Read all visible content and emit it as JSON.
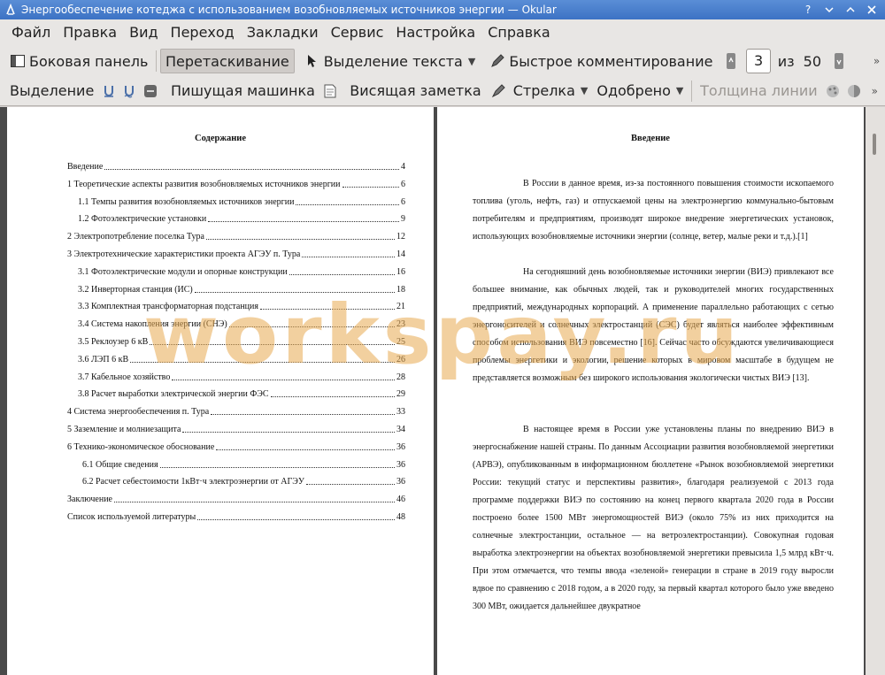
{
  "window": {
    "title": "Энергообеспечение котеджа с использованием возобновляемых источников энергии  — Okular",
    "icons": [
      "okular-app-icon",
      "help-icon",
      "minimize-icon",
      "maximize-icon",
      "close-icon"
    ]
  },
  "menu": [
    "Файл",
    "Правка",
    "Вид",
    "Переход",
    "Закладки",
    "Сервис",
    "Настройка",
    "Справка"
  ],
  "toolbar1": {
    "sidebar": "Боковая панель",
    "drag": "Перетаскивание",
    "text_select": "Выделение текста",
    "quick_comment": "Быстрое комментирование",
    "page_current": "3",
    "page_of": "из",
    "page_total": "50"
  },
  "toolbar2": {
    "selection": "Выделение",
    "typewriter": "Пишущая машинка",
    "note": "Висящая заметка",
    "arrow": "Стрелка",
    "approved": "Одобрено",
    "line_width": "Толщина линии"
  },
  "left_page": {
    "heading": "Содержание",
    "toc": [
      {
        "title": "Введение",
        "page": "4"
      },
      {
        "title": "1 Теоретические аспекты развития возобновляемых источников энергии",
        "page": "6"
      },
      {
        "title": "1.1 Темпы развития возобновляемых источников энергии",
        "page": "6"
      },
      {
        "title": "1.2 Фотоэлектрические установки",
        "page": "9"
      },
      {
        "title": "2 Электропотребление поселка Тура",
        "page": "12"
      },
      {
        "title": "3 Электротехнические характеристики проекта АГЭУ п. Тура",
        "page": "14"
      },
      {
        "title": "3.1 Фотоэлектрические модули и опорные конструкции",
        "page": "16"
      },
      {
        "title": "3.2 Инверторная станция (ИС)",
        "page": "18"
      },
      {
        "title": "3.3 Комплектная трансформаторная подстанция",
        "page": "21"
      },
      {
        "title": "3.4 Система накопления энергии (СНЭ)",
        "page": "23"
      },
      {
        "title": "3.5 Реклоузер 6 кВ",
        "page": "25"
      },
      {
        "title": "3.6 ЛЭП 6 кВ",
        "page": "26"
      },
      {
        "title": "3.7 Кабельное хозяйство",
        "page": "28"
      },
      {
        "title": "3.8 Расчет выработки электрической энергии ФЭС",
        "page": "29"
      },
      {
        "title": "4 Система энергообеспечения п. Тура",
        "page": "33"
      },
      {
        "title": "5 Заземление и молниезащита",
        "page": "34"
      },
      {
        "title": "6 Технико-экономическое обоснование",
        "page": "36"
      },
      {
        "title": "6.1 Общие сведения",
        "page": "36"
      },
      {
        "title": "6.2 Расчет себестоимости 1кВт·ч электроэнергии от АГЭУ",
        "page": "36"
      },
      {
        "title": "Заключение",
        "page": "46"
      },
      {
        "title": "Список используемой литературы",
        "page": "48"
      }
    ]
  },
  "right_page": {
    "heading": "Введение",
    "paragraphs": [
      "В России в данное время, из-за постоянного повышения стоимости ископаемого топлива (уголь, нефть, газ) и отпускаемой цены на электроэнергию коммунально-бытовым потребителям и предприятиям, производят широкое внедрение энергетических установок, использующих возобновляемые источники энергии (солнце, ветер, малые реки и т.д.).[1]",
      "На сегодняшний день возобновляемые источники энергии (ВИЭ) привлекают все большее внимание, как обычных людей, так и руководителей многих государственных предприятий, международных корпораций. А применение параллельно работающих с сетью энергоносителей и солнечных электростанций (СЭС) будет являться наиболее эффективным способом использования ВИЭ повсеместно [16]. Сейчас часто обсуждаются увеличивающиеся проблемы энергетики и экологии, решение которых в мировом масштабе в будущем не представляется возможным без широкого использования экологически чистых ВИЭ [13].",
      "В настоящее время в России уже установлены планы по внедрению ВИЭ в энергоснабжение нашей страны. По данным Ассоциации развития возобновляемой энергетики (АРВЭ), опубликованным в информационном бюллетене «Рынок возобновляемой энергетики России: текущий статус и перспективы развития», благодаря реализуемой с 2013 года программе поддержки ВИЭ по состоянию на конец первого квартала 2020 года в России построено более 1500 МВт энергомощностей ВИЭ (около 75% из них приходится на солнечные электростанции, остальное — на ветроэлектростанции). Совокупная годовая выработка электроэнергии на объектах возобновляемой энергетики превысила 1,5 млрд кВт·ч. При этом отмечается, что темпы ввода «зеленой» генерации в стране в 2019 году выросли вдвое по сравнению с 2018 годом, а в 2020 году, за первый квартал которого было уже введено 300 МВт, ожидается дальнейшее двукратное"
    ]
  },
  "watermark": "workspay.ru",
  "colors": {
    "titlebar": "#4a82cc",
    "chrome": "#e8e6e4",
    "viewport_bg": "#4a4a4a",
    "watermark": "#e8aa50"
  }
}
